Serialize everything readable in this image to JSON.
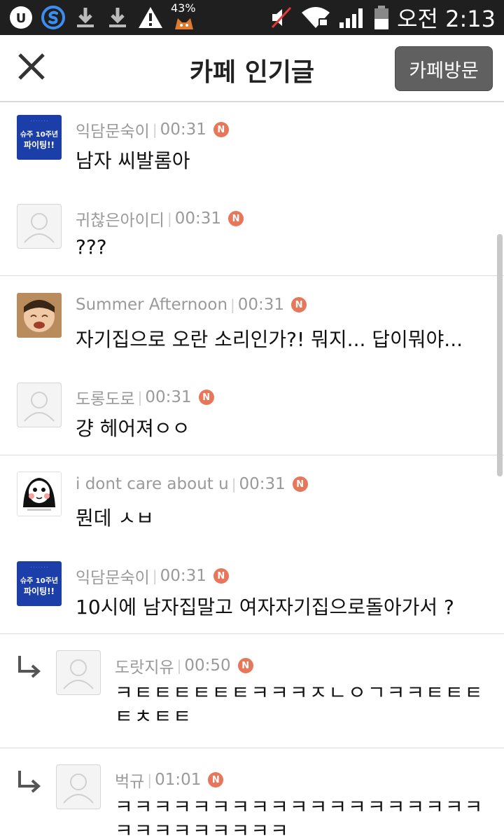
{
  "status_bar": {
    "battery_percent": "43%",
    "clock": "오전 2:13",
    "icons": [
      "u-app-icon",
      "s-app-icon",
      "download-icon",
      "download-icon",
      "warning-icon",
      "cat-app-icon",
      "mute-icon",
      "wifi-icon",
      "signal-icon",
      "battery-icon"
    ]
  },
  "header": {
    "title": "카페 인기글",
    "visit_button": "카페방문"
  },
  "comments": [
    {
      "author": "익담문숙이",
      "time": "00:31",
      "badge": "N",
      "text": "남자 씨발롬아",
      "avatar": "banner",
      "avatar_text": [
        "슈주 10주년",
        "파이팅!!"
      ],
      "reply": false
    },
    {
      "author": "귀찮은아이디",
      "time": "00:31",
      "badge": "N",
      "text": "???",
      "avatar": "blank",
      "reply": false
    },
    {
      "author": "Summer Afternoon",
      "time": "00:31",
      "badge": "N",
      "text": "자기집으로 오란 소리인가?! 뭐지... 답이뭐야...",
      "avatar": "photo",
      "reply": false
    },
    {
      "author": "도롱도로",
      "time": "00:31",
      "badge": "N",
      "text": "걍 헤어져ㅇㅇ",
      "avatar": "blank",
      "reply": false
    },
    {
      "author": "i dont care about u",
      "time": "00:31",
      "badge": "N",
      "text": "뭔데 ㅅㅂ",
      "avatar": "cartoon",
      "reply": false
    },
    {
      "author": "익담문숙이",
      "time": "00:31",
      "badge": "N",
      "text": "10시에 남자집말고 여자자기집으로돌아가서 ?",
      "avatar": "banner",
      "avatar_text": [
        "슈주 10주년",
        "파이팅!!"
      ],
      "reply": false
    },
    {
      "author": "도랏지유",
      "time": "00:50",
      "badge": "N",
      "text": "ㅋㅌㅌㅌㅌㅌㅌㅋㅋㅋㅈㄴㅇㄱㅋㅋㅌㅌㅌㅌㅊㅌㅌ",
      "avatar": "blank",
      "reply": true
    },
    {
      "author": "벅규",
      "time": "01:01",
      "badge": "N",
      "text": "ㅋㅋㅋㅋㅋㅋㅋㅋㅋㅋㅋㅋㅋㅋㅋㅋㅋㅋㅋㅋㅋㅋㅋㅋㅋㅋㅋㅋ",
      "avatar": "blank",
      "reply": true
    }
  ]
}
